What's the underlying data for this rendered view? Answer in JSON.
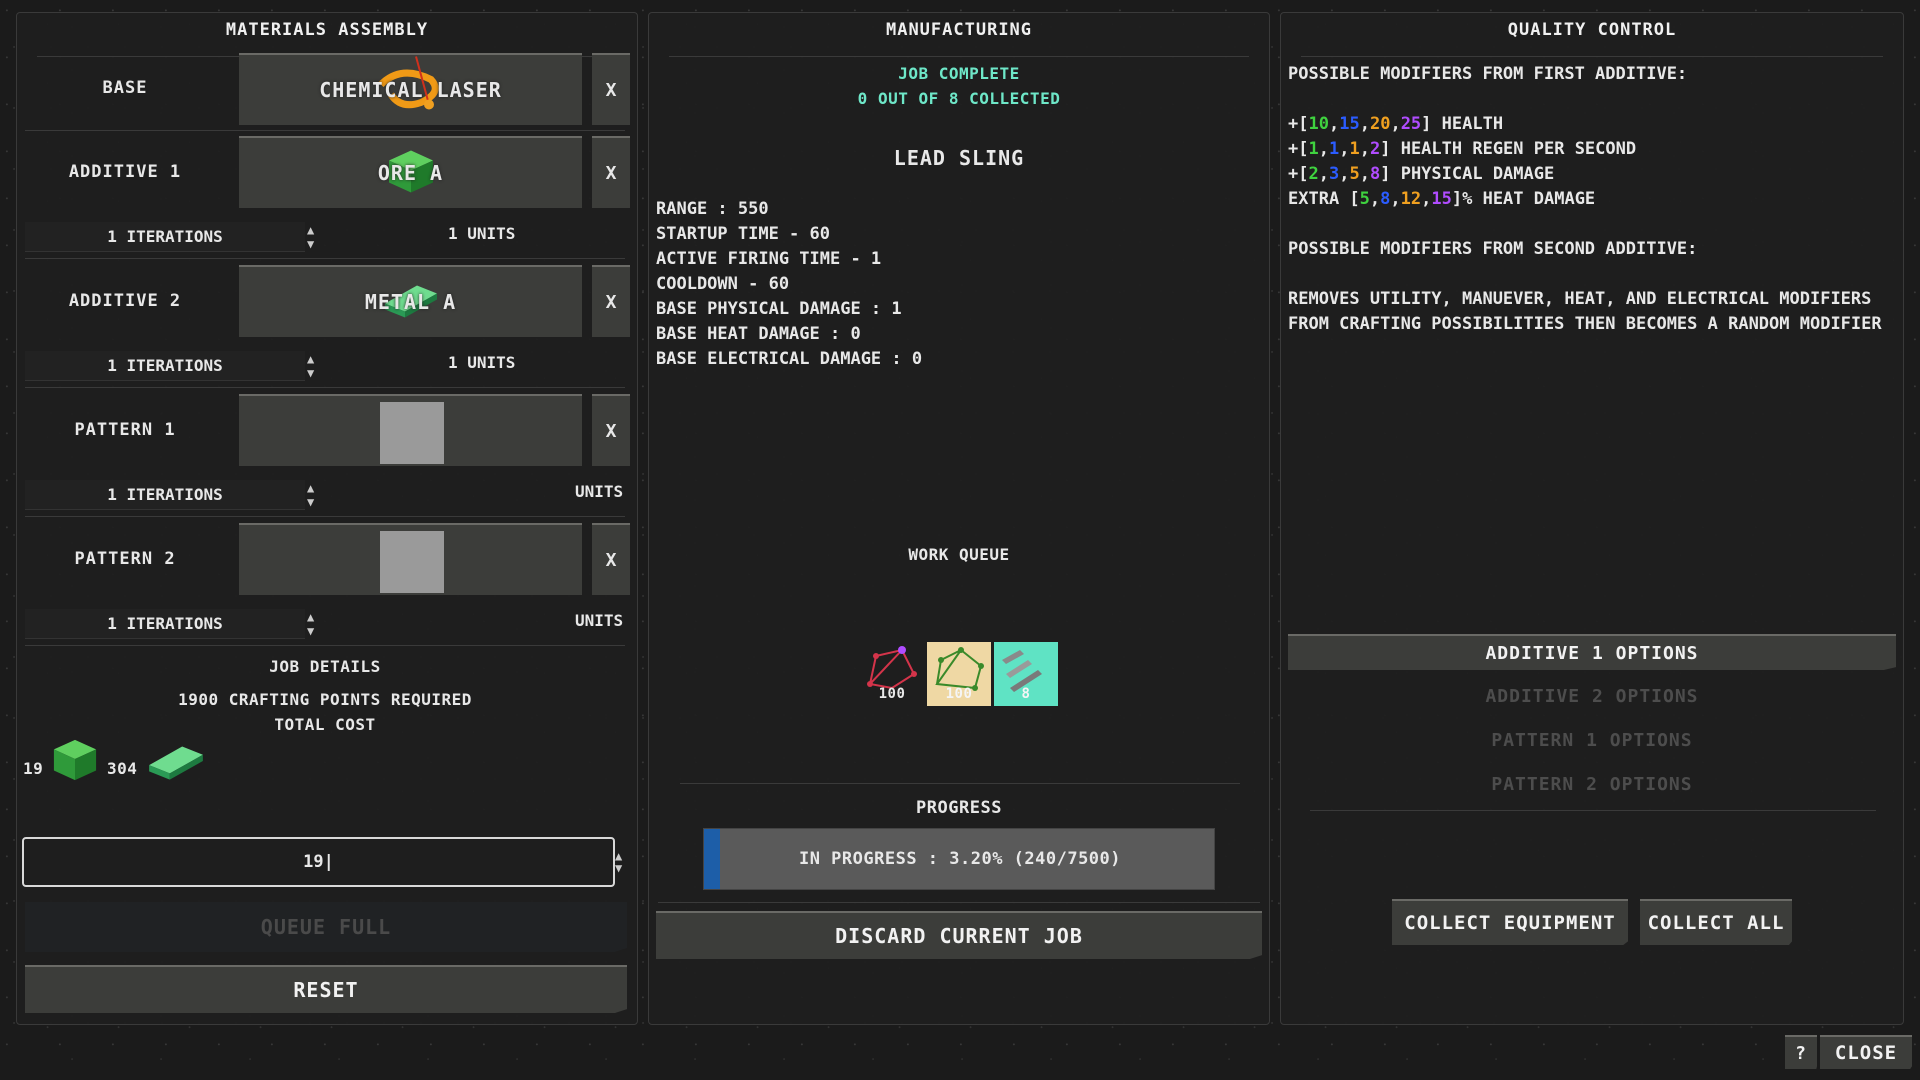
{
  "colors": {
    "accent_teal": "#6ee7c8",
    "progress_fill": "#1d5ea8",
    "mod_green": "#3fd23f",
    "mod_blue": "#2b5cff",
    "mod_orange": "#f0a020",
    "mod_purple": "#b04cff"
  },
  "materials": {
    "title": "MATERIALS ASSEMBLY",
    "slots": [
      {
        "label": "BASE",
        "item": "CHEMICAL LASER",
        "icon": "laser-icon",
        "remove": "X"
      },
      {
        "label": "ADDITIVE 1",
        "item": "ORE A",
        "icon": "ore-crate-icon",
        "remove": "X",
        "iterations": "1 ITERATIONS",
        "units": "1 UNITS"
      },
      {
        "label": "ADDITIVE 2",
        "item": "METAL A",
        "icon": "metal-bar-icon",
        "remove": "X",
        "iterations": "1 ITERATIONS",
        "units": "1 UNITS"
      },
      {
        "label": "PATTERN 1",
        "item": "",
        "icon": "empty-slot",
        "remove": "X",
        "iterations": "1 ITERATIONS",
        "units": "UNITS"
      },
      {
        "label": "PATTERN 2",
        "item": "",
        "icon": "empty-slot",
        "remove": "X",
        "iterations": "1 ITERATIONS",
        "units": "UNITS"
      }
    ],
    "job_details": {
      "title": "JOB DETAILS",
      "points": "1900 CRAFTING POINTS REQUIRED",
      "total_cost": "TOTAL COST",
      "costs": [
        {
          "amount": "19",
          "icon": "ore-crate-icon"
        },
        {
          "amount": "304",
          "icon": "metal-bar-icon"
        }
      ]
    },
    "quantity_value": "19",
    "queue_button": "QUEUE FULL",
    "reset_button": "RESET"
  },
  "manufacturing": {
    "title": "MANUFACTURING",
    "status_line1": "JOB COMPLETE",
    "status_line2": "0 OUT OF 8 COLLECTED",
    "item_name": "LEAD SLING",
    "stats": [
      "RANGE : 550",
      "STARTUP TIME - 60",
      "ACTIVE FIRING TIME - 1",
      "COOLDOWN - 60",
      "BASE PHYSICAL DAMAGE : 1",
      "BASE HEAT DAMAGE : 0",
      "BASE ELECTRICAL DAMAGE : 0"
    ],
    "work_queue_title": "WORK QUEUE",
    "queue_items": [
      {
        "icon": "pattern-red-icon",
        "count": "100",
        "bg": "#1e1e1e"
      },
      {
        "icon": "pattern-green-icon",
        "count": "100",
        "bg": "#efd8a4"
      },
      {
        "icon": "sling-ammo-icon",
        "count": "8",
        "bg": "#5fe3c4"
      }
    ],
    "progress_title": "PROGRESS",
    "progress_text": "IN PROGRESS : 3.20% (240/7500)",
    "progress_fraction": 0.032,
    "discard_button": "DISCARD CURRENT JOB"
  },
  "quality": {
    "title": "QUALITY CONTROL",
    "first_header": "POSSIBLE MODIFIERS FROM FIRST ADDITIVE:",
    "modifiers": [
      {
        "prefix": "+[",
        "values": [
          "10",
          "15",
          "20",
          "25"
        ],
        "suffix": "] HEALTH"
      },
      {
        "prefix": "+[",
        "values": [
          "1",
          "1",
          "1",
          "2"
        ],
        "suffix": "] HEALTH REGEN PER SECOND"
      },
      {
        "prefix": "+[",
        "values": [
          "2",
          "3",
          "5",
          "8"
        ],
        "suffix": "] PHYSICAL DAMAGE"
      },
      {
        "prefix": "EXTRA [",
        "values": [
          "5",
          "8",
          "12",
          "15"
        ],
        "suffix": "]% HEAT DAMAGE"
      }
    ],
    "second_header": "POSSIBLE MODIFIERS FROM SECOND ADDITIVE:",
    "second_text": "REMOVES UTILITY, MANUEVER, HEAT, AND ELECTRICAL MODIFIERS FROM CRAFTING POSSIBILITIES THEN BECOMES A RANDOM MODIFIER",
    "options": [
      "ADDITIVE 1 OPTIONS",
      "ADDITIVE 2 OPTIONS",
      "PATTERN 1 OPTIONS",
      "PATTERN 2 OPTIONS"
    ],
    "collect_equipment": "COLLECT EQUIPMENT",
    "collect_all": "COLLECT ALL"
  },
  "footer": {
    "help": "?",
    "close": "CLOSE"
  }
}
